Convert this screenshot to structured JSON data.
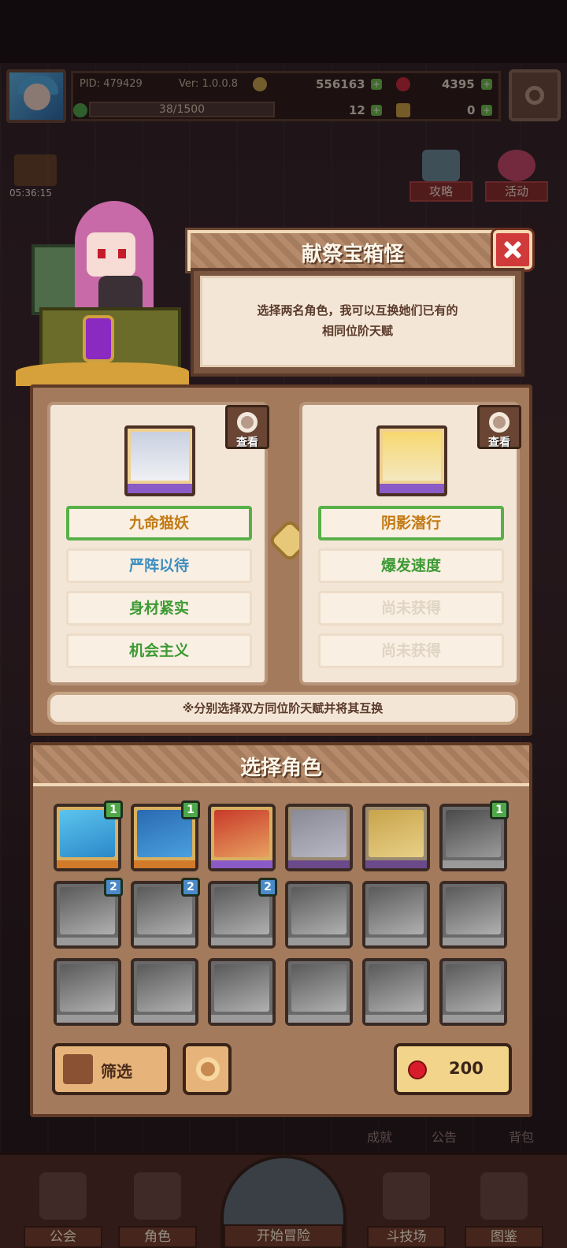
{
  "hud": {
    "pid": "PID: 479429",
    "version": "Ver: 1.0.0.8",
    "gold": "556163",
    "gems": "4395",
    "exp": "38/1500",
    "clovers": "12",
    "keys": "0",
    "timer": "05:36:15"
  },
  "side": {
    "guide_label": "攻略",
    "event_label": "活动"
  },
  "dialog": {
    "title": "献祭宝箱怪",
    "description_line1": "选择两名角色，我可以互换她们已有的",
    "description_line2": "相同位阶天赋",
    "view_label": "查看",
    "left_traits": [
      "九命猫妖",
      "严阵以待",
      "身材紧实",
      "机会主义"
    ],
    "right_traits": [
      "阴影潜行",
      "爆发速度",
      "尚未获得",
      "尚未获得"
    ],
    "hint": "※分别选择双方同位阶天赋并将其互换"
  },
  "select": {
    "title": "选择角色",
    "badges": [
      "1",
      "1",
      "",
      "",
      "",
      "1",
      "2",
      "2",
      "2",
      "",
      "",
      "",
      "",
      "",
      "",
      "",
      "",
      ""
    ],
    "filter_label": "筛选",
    "cost": "200"
  },
  "under": {
    "achievements": "成就",
    "notice": "公告",
    "bag": "背包"
  },
  "nav": {
    "guild": "公会",
    "characters": "角色",
    "start": "开始冒险",
    "arena": "斗技场",
    "codex": "图鉴"
  },
  "colors": {
    "accent_green": "#58b048",
    "close_red": "#d03a3a",
    "rarity_purple": "#8a5ac6",
    "rarity_orange": "#d07a2a"
  }
}
